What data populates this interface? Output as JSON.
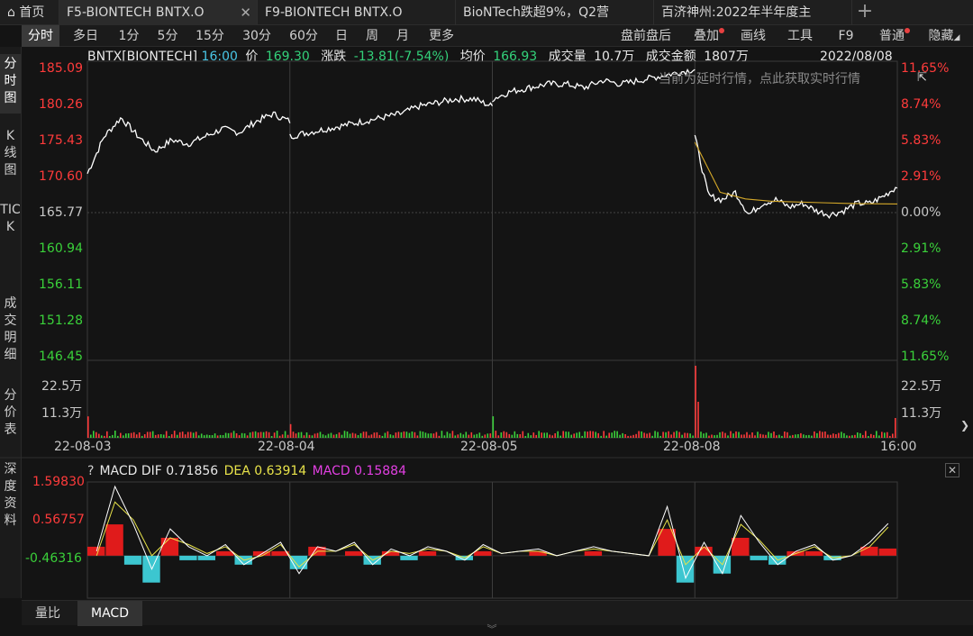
{
  "tabs": [
    {
      "label": "首页",
      "icon": "home-icon"
    },
    {
      "label": "F5-BIONTECH BNTX.O",
      "close": "✕"
    },
    {
      "label": "F9-BIONTECH BNTX.O"
    },
    {
      "label": "BioNTech跌超9%，Q2营"
    },
    {
      "label": "百济神州:2022年半年度主"
    }
  ],
  "tab_add": "+",
  "toolbar": {
    "periods": [
      "分时",
      "多日",
      "1分",
      "5分",
      "15分",
      "30分",
      "60分",
      "日",
      "周",
      "月",
      "更多"
    ],
    "right": [
      "盘前盘后",
      "叠加",
      "画线",
      "工具",
      "F9",
      "普通",
      "隐藏"
    ],
    "hide_arrow": "◢"
  },
  "leftnav": [
    "分时图",
    "K线图",
    "TICK",
    "成交明细",
    "分价表",
    "深度资料"
  ],
  "quote": {
    "symbol": "BNTX[BIONTECH]",
    "time": "16:00",
    "price_label": "价",
    "price": "169.30",
    "change_label": "涨跌",
    "change": "-13.81(-7.54%)",
    "avg_label": "均价",
    "avg": "166.93",
    "volume_label": "成交量",
    "volume": "10.7万",
    "amount_label": "成交金额",
    "amount": "1807万",
    "date": "2022/08/08"
  },
  "delayed_notice": "当前为延时行情，点此获取实时行情",
  "chart_data": {
    "type": "line",
    "y_left_ticks": [
      "185.09",
      "180.26",
      "175.43",
      "170.60",
      "165.77",
      "160.94",
      "156.11",
      "151.28",
      "146.45"
    ],
    "y_right_ticks": [
      "11.65%",
      "8.74%",
      "5.83%",
      "2.91%",
      "0.00%",
      "2.91%",
      "5.83%",
      "8.74%",
      "11.65%"
    ],
    "prev_close": 165.77,
    "ylim": [
      146.45,
      185.09
    ],
    "volume_ticks": [
      "22.5万",
      "11.3万"
    ],
    "x_labels": [
      "22-08-03",
      "22-08-04",
      "22-08-05",
      "22-08-08",
      "16:00"
    ],
    "price_days": [
      [
        171,
        176,
        178.5,
        176,
        174,
        175.5,
        175,
        176,
        177,
        176.5,
        178,
        179,
        178
      ],
      [
        176,
        176.5,
        177,
        177.5,
        178,
        178.5,
        179,
        180,
        180.5,
        181,
        181,
        180
      ],
      [
        181,
        182,
        182.5,
        183,
        183,
        182.5,
        183.5,
        183,
        183.5,
        184,
        184.5,
        185
      ],
      [
        176,
        168,
        167.5,
        168.5,
        165.5,
        167,
        167.5,
        166.5,
        167,
        166,
        165.5,
        166,
        167,
        167,
        168,
        169.3
      ]
    ],
    "avg_line": [
      175.2,
      168.5,
      167.6,
      167.3,
      167.2,
      167.1,
      167.0,
      166.95,
      166.93
    ],
    "macd": {
      "label": "MACD",
      "dif_label": "DIF",
      "dif": "0.71856",
      "dea_label": "DEA",
      "dea": "0.63914",
      "macd_label": "MACD",
      "macd": "0.15884",
      "y_ticks": [
        "1.59830",
        "0.56757",
        "-0.46316"
      ],
      "ylim": [
        -0.95,
        1.65
      ],
      "dif_values": [
        0.1,
        1.55,
        0.7,
        -0.3,
        0.6,
        0.2,
        0.0,
        0.25,
        -0.2,
        0.05,
        0.3,
        -0.4,
        0.2,
        0.1,
        0.3,
        -0.2,
        0.15,
        0.0,
        0.2,
        0.1,
        -0.1,
        0.25,
        0.05,
        0.1,
        0.15,
        0.0,
        0.1,
        0.2,
        0.1,
        0.05,
        0.0,
        1.1,
        -0.5,
        0.3,
        -0.4,
        0.9,
        0.3,
        -0.2,
        0.1,
        0.25,
        -0.1,
        0.0,
        0.3,
        0.72
      ],
      "dea_values": [
        0.0,
        1.2,
        0.8,
        0.0,
        0.4,
        0.25,
        0.05,
        0.2,
        -0.1,
        0.0,
        0.25,
        -0.25,
        0.1,
        0.1,
        0.25,
        -0.1,
        0.1,
        0.05,
        0.15,
        0.1,
        -0.05,
        0.2,
        0.05,
        0.1,
        0.1,
        0.0,
        0.1,
        0.15,
        0.1,
        0.05,
        0.0,
        0.8,
        -0.2,
        0.2,
        -0.2,
        0.7,
        0.35,
        -0.1,
        0.05,
        0.2,
        -0.05,
        0.0,
        0.2,
        0.64
      ],
      "hist_values": [
        0.2,
        0.7,
        -0.2,
        -0.6,
        0.4,
        -0.1,
        -0.1,
        0.1,
        -0.2,
        0.1,
        0.1,
        -0.3,
        0.2,
        0.0,
        0.1,
        -0.2,
        0.1,
        -0.1,
        0.1,
        0.0,
        -0.1,
        0.1,
        0.0,
        0.0,
        0.1,
        0.0,
        0.0,
        0.1,
        0.0,
        0.0,
        0.0,
        0.6,
        -0.6,
        0.2,
        -0.4,
        0.4,
        -0.1,
        -0.2,
        0.1,
        0.1,
        -0.1,
        0.0,
        0.2,
        0.16
      ]
    },
    "colors": {
      "up": "#ff3b3b",
      "down": "#3ad13a",
      "price": "#ffffff",
      "avg": "#d4a829",
      "dif": "#ffffff",
      "dea": "#e8e34a",
      "hist_up": "#e01b1b",
      "hist_down": "#3cc6d0"
    }
  },
  "bottom_tabs": [
    "量比",
    "MACD"
  ],
  "close_glyph": "✕",
  "question": "?"
}
